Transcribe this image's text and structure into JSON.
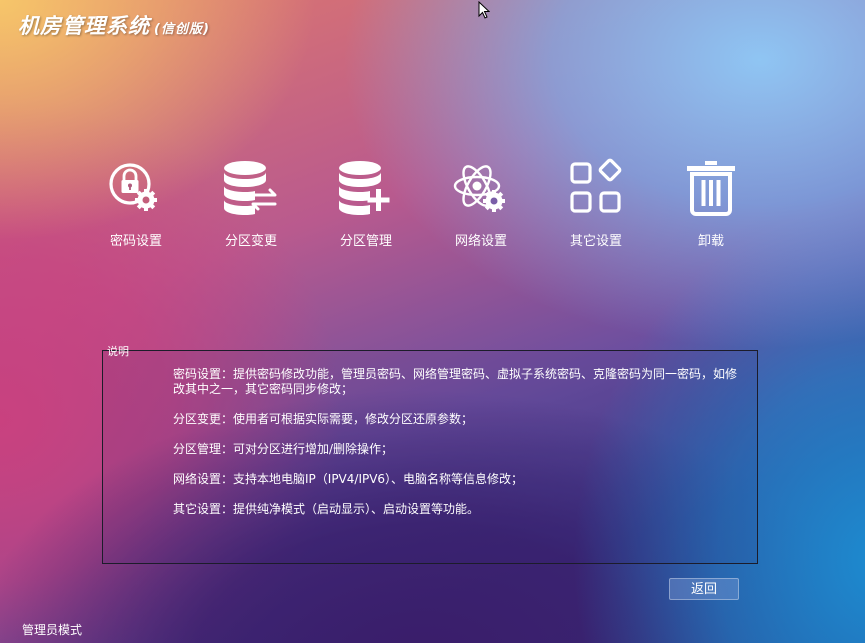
{
  "app": {
    "title": "机房管理系统",
    "edition": "(信创版)"
  },
  "menu": [
    {
      "label": "密码设置",
      "icon": "lock-gear-icon"
    },
    {
      "label": "分区变更",
      "icon": "database-swap-icon"
    },
    {
      "label": "分区管理",
      "icon": "database-add-icon"
    },
    {
      "label": "网络设置",
      "icon": "atom-gear-icon"
    },
    {
      "label": "其它设置",
      "icon": "grid-diamond-icon"
    },
    {
      "label": "卸载",
      "icon": "trash-icon"
    }
  ],
  "description": {
    "legend": "说明",
    "lines": [
      "密码设置：提供密码修改功能，管理员密码、网络管理密码、虚拟子系统密码、克隆密码为同一密码，如修改其中之一，其它密码同步修改；",
      "分区变更：使用者可根据实际需要，修改分区还原参数；",
      "分区管理：可对分区进行增加/删除操作；",
      "网络设置：支持本地电脑IP（IPV4/IPV6）、电脑名称等信息修改；",
      "其它设置：提供纯净模式（启动显示）、启动设置等功能。"
    ]
  },
  "buttons": {
    "back": "返回"
  },
  "status": {
    "mode": "管理员模式"
  },
  "colors": {
    "icon": "#ffffff",
    "border": "#1c1c2a"
  }
}
